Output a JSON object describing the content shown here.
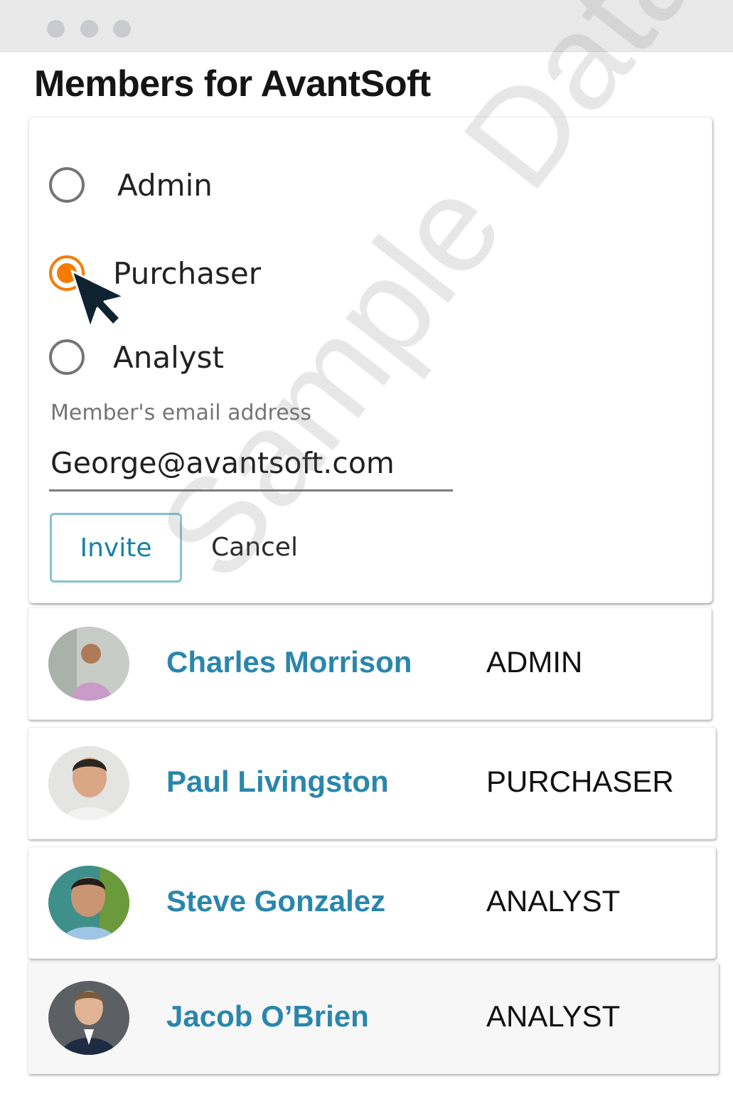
{
  "page": {
    "title": "Members for AvantSoft",
    "watermark": "Sample Data"
  },
  "invite_form": {
    "roles": [
      {
        "label": "Admin",
        "selected": false
      },
      {
        "label": "Purchaser",
        "selected": true
      },
      {
        "label": "Analyst",
        "selected": false
      }
    ],
    "email_label": "Member's email address",
    "email_value": "George@avantsoft.com",
    "invite_label": "Invite",
    "cancel_label": "Cancel"
  },
  "members": [
    {
      "name": "Charles Morrison",
      "role": "ADMIN"
    },
    {
      "name": "Paul Livingston",
      "role": "PURCHASER"
    },
    {
      "name": "Steve Gonzalez",
      "role": "ANALYST"
    },
    {
      "name": "Jacob O’Brien",
      "role": "ANALYST"
    }
  ],
  "colors": {
    "accent_orange": "#f57c00",
    "link_blue": "#2a86ac",
    "invite_blue": "#1681a6"
  }
}
